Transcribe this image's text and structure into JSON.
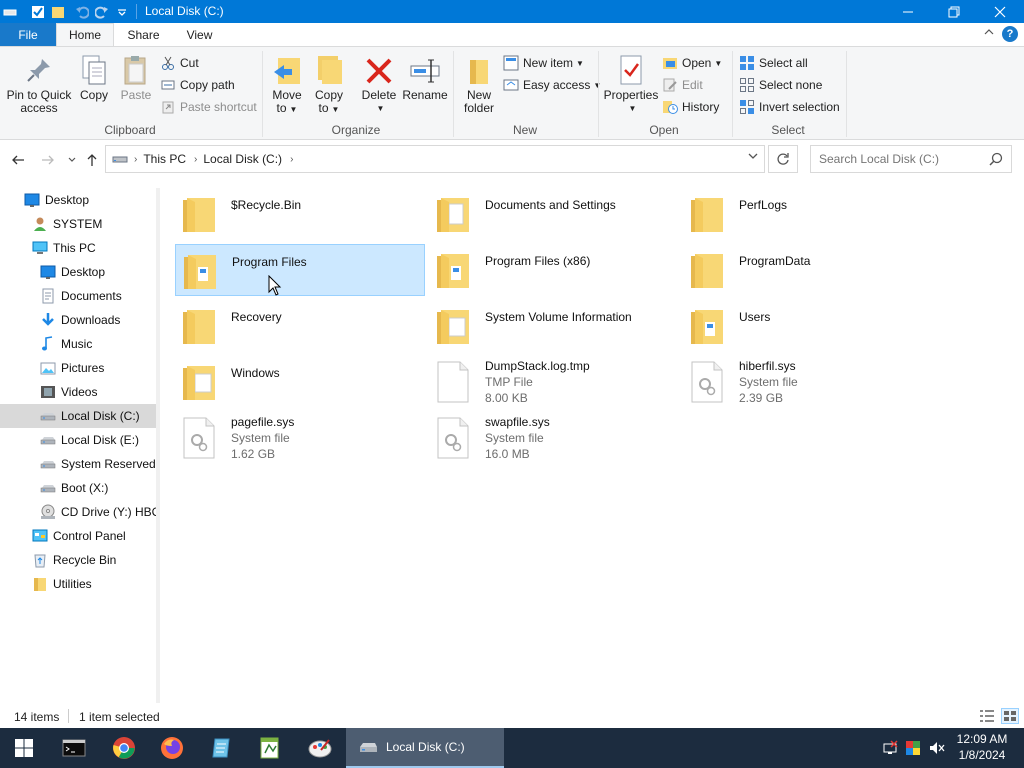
{
  "window": {
    "title": "Local Disk (C:)"
  },
  "ribbon_tabs": {
    "file": "File",
    "home": "Home",
    "share": "Share",
    "view": "View"
  },
  "clipboard": {
    "label": "Clipboard",
    "pin_line1": "Pin to Quick",
    "pin_line2": "access",
    "copy": "Copy",
    "paste": "Paste",
    "cut": "Cut",
    "copy_path": "Copy path",
    "paste_shortcut": "Paste shortcut"
  },
  "organize": {
    "label": "Organize",
    "move_line1": "Move",
    "move_line2": "to",
    "copy_line1": "Copy",
    "copy_line2": "to",
    "delete": "Delete",
    "rename": "Rename"
  },
  "new_group": {
    "label": "New",
    "folder_line1": "New",
    "folder_line2": "folder",
    "new_item": "New item",
    "easy_access": "Easy access"
  },
  "open_group": {
    "label": "Open",
    "properties": "Properties",
    "open": "Open",
    "edit": "Edit",
    "history": "History"
  },
  "select_group": {
    "label": "Select",
    "select_all": "Select all",
    "select_none": "Select none",
    "invert": "Invert selection"
  },
  "address": {
    "crumbs": [
      "This PC",
      "Local Disk (C:)"
    ],
    "search_placeholder": "Search Local Disk (C:)"
  },
  "nav_pane": [
    {
      "label": "Desktop",
      "icon": "desktop-blue-icon"
    },
    {
      "label": "SYSTEM",
      "icon": "user-icon"
    },
    {
      "label": "This PC",
      "icon": "computer-icon"
    },
    {
      "label": "Desktop",
      "icon": "desktop-blue-icon"
    },
    {
      "label": "Documents",
      "icon": "documents-icon"
    },
    {
      "label": "Downloads",
      "icon": "downloads-icon"
    },
    {
      "label": "Music",
      "icon": "music-icon"
    },
    {
      "label": "Pictures",
      "icon": "pictures-icon"
    },
    {
      "label": "Videos",
      "icon": "videos-icon"
    },
    {
      "label": "Local Disk (C:)",
      "icon": "drive-icon"
    },
    {
      "label": "Local Disk (E:)",
      "icon": "drive-icon"
    },
    {
      "label": "System Reserved (",
      "icon": "drive-icon"
    },
    {
      "label": "Boot (X:)",
      "icon": "drive-icon"
    },
    {
      "label": "CD Drive (Y:) HBC",
      "icon": "cd-drive-icon"
    },
    {
      "label": "Control Panel",
      "icon": "control-panel-icon"
    },
    {
      "label": "Recycle Bin",
      "icon": "recycle-bin-icon"
    },
    {
      "label": "Utilities",
      "icon": "folder-icon"
    }
  ],
  "files": [
    {
      "name": "$Recycle.Bin",
      "type": "",
      "size": ""
    },
    {
      "name": "Documents and Settings",
      "type": "",
      "size": ""
    },
    {
      "name": "PerfLogs",
      "type": "",
      "size": ""
    },
    {
      "name": "Program Files",
      "type": "",
      "size": ""
    },
    {
      "name": "Program Files (x86)",
      "type": "",
      "size": ""
    },
    {
      "name": "ProgramData",
      "type": "",
      "size": ""
    },
    {
      "name": "Recovery",
      "type": "",
      "size": ""
    },
    {
      "name": "System Volume Information",
      "type": "",
      "size": ""
    },
    {
      "name": "Users",
      "type": "",
      "size": ""
    },
    {
      "name": "Windows",
      "type": "",
      "size": ""
    },
    {
      "name": "DumpStack.log.tmp",
      "type": "TMP File",
      "size": "8.00 KB"
    },
    {
      "name": "hiberfil.sys",
      "type": "System file",
      "size": "2.39 GB"
    },
    {
      "name": "pagefile.sys",
      "type": "System file",
      "size": "1.62 GB"
    },
    {
      "name": "swapfile.sys",
      "type": "System file",
      "size": "16.0 MB"
    }
  ],
  "status": {
    "count": "14 items",
    "selected": "1 item selected"
  },
  "taskbar": {
    "window_label": "Local Disk (C:)",
    "time": "12:09 AM",
    "date": "1/8/2024"
  },
  "colors": {
    "accent": "#0078d7",
    "selection": "#cce8ff",
    "folder": "#f8d775",
    "taskbar": "#1c2c3f"
  }
}
